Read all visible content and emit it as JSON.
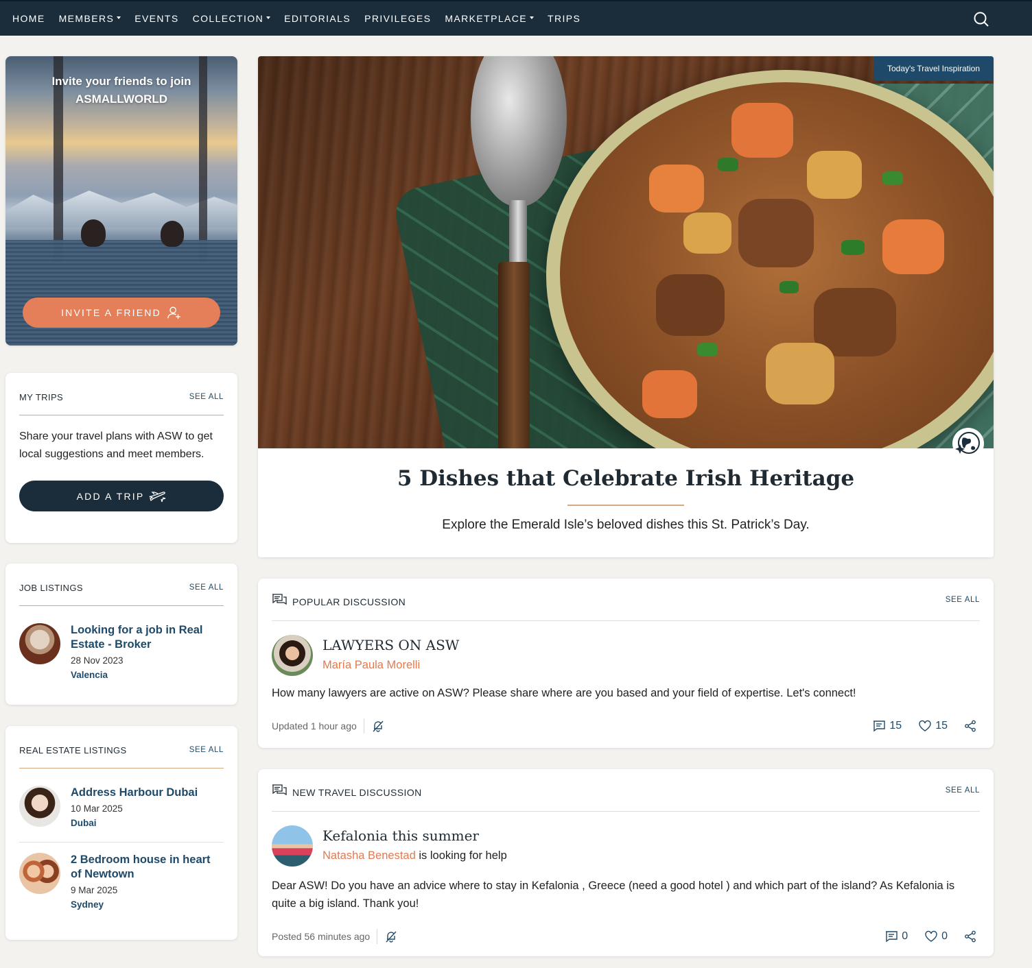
{
  "nav": {
    "items": [
      {
        "label": "HOME",
        "dropdown": false
      },
      {
        "label": "MEMBERS",
        "dropdown": true
      },
      {
        "label": "EVENTS",
        "dropdown": false
      },
      {
        "label": "COLLECTION",
        "dropdown": true
      },
      {
        "label": "EDITORIALS",
        "dropdown": false
      },
      {
        "label": "PRIVILEGES",
        "dropdown": false
      },
      {
        "label": "MARKETPLACE",
        "dropdown": true
      },
      {
        "label": "TRIPS",
        "dropdown": false
      }
    ],
    "search_icon": "search-icon"
  },
  "invite": {
    "title_line1": "Invite your friends to join",
    "title_line2": "ASMALLWORLD",
    "button_label": "INVITE A FRIEND",
    "button_icon": "add-user-icon"
  },
  "my_trips": {
    "title": "MY TRIPS",
    "see_all": "SEE ALL",
    "text": "Share your travel plans with ASW to get local suggestions and meet members.",
    "button_label": "ADD A TRIP",
    "button_icon": "plane-icon"
  },
  "job_listings": {
    "title": "JOB LISTINGS",
    "see_all": "SEE ALL",
    "items": [
      {
        "title": "Looking for a job in Real Estate - Broker",
        "date": "28 Nov 2023",
        "location": "Valencia"
      }
    ]
  },
  "real_estate": {
    "title": "REAL ESTATE LISTINGS",
    "see_all": "SEE ALL",
    "items": [
      {
        "title": "Address Harbour Dubai",
        "date": "10 Mar 2025",
        "location": "Dubai"
      },
      {
        "title": "2 Bedroom house in heart of Newtown",
        "date": "9 Mar 2025",
        "location": "Sydney"
      }
    ]
  },
  "feature": {
    "badge": "Today's Travel Inspiration",
    "title": "5 Dishes that Celebrate Irish Heritage",
    "subtitle": "Explore the Emerald Isle’s beloved dishes this St. Patrick’s Day."
  },
  "popular_discussion": {
    "section_title": "POPULAR DISCUSSION",
    "see_all": "SEE ALL",
    "post_title": "LAWYERS ON ASW",
    "author": "María Paula Morelli",
    "author_suffix": "",
    "body": "How many lawyers are active on ASW? Please share where are you based and your field of expertise. Let's connect!",
    "timestamp": "Updated 1 hour ago",
    "comments": "15",
    "likes": "15"
  },
  "travel_discussion": {
    "section_title": "NEW TRAVEL DISCUSSION",
    "see_all": "SEE ALL",
    "post_title": "Kefalonia this summer",
    "author": "Natasha Benestad",
    "author_suffix": " is looking for help",
    "body": "Dear ASW! Do you have an advice where to stay in Kefalonia , Greece (need a good hotel ) and which part of the island? As Kefalonia is quite a big island. Thank you!",
    "timestamp": "Posted 56 minutes ago",
    "comments": "0",
    "likes": "0"
  },
  "colors": {
    "nav_bg": "#1b2d3b",
    "accent_orange": "#e57f59",
    "link_blue": "#1e4968",
    "divider_gold": "#d7a77d"
  }
}
